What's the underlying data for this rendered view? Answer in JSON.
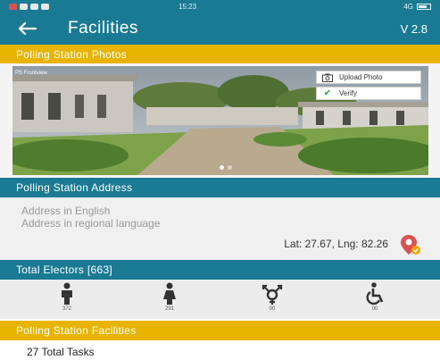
{
  "status_bar": {
    "time": "15:23",
    "network": "4G"
  },
  "app_bar": {
    "title": "Facilities",
    "version": "V 2.8",
    "back_icon": "arrow-left-icon"
  },
  "photos_section": {
    "title": "Polling Station Photos",
    "caption": "PS Frontview",
    "upload_label": "Upload Photo",
    "verify_label": "Verify",
    "carousel_pages": 2,
    "carousel_current": 1
  },
  "address_section": {
    "title": "Polling Station Address",
    "address_english_placeholder": "Address in English",
    "address_regional_placeholder": "Address in regional language",
    "latlng": "Lat: 27.67, Lng: 82.26"
  },
  "electors_section": {
    "title": "Total Electors [663]",
    "groups": [
      {
        "icon": "male-icon",
        "count": "372"
      },
      {
        "icon": "female-icon",
        "count": "291"
      },
      {
        "icon": "third-gender-icon",
        "count": "00"
      },
      {
        "icon": "wheelchair-icon",
        "count": "00"
      }
    ]
  },
  "facilities_section": {
    "title": "Polling Station Facilities",
    "total_tasks": "27 Total Tasks"
  },
  "colors": {
    "teal": "#1b7a93",
    "yellow": "#e8b400"
  }
}
